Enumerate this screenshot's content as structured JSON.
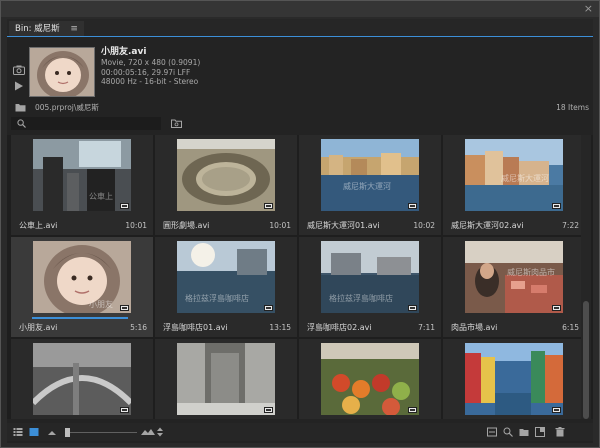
{
  "panel": {
    "tab_label": "Bin: 威尼斯",
    "tab_menu_glyph": "≡",
    "close_glyph": "×"
  },
  "preview": {
    "clip_name": "小朋友.avi",
    "line1": "Movie, 720 x 480 (0.9091)",
    "line2": "00:00:05:16, 29.97i LFF",
    "line3": "48000 Hz - 16-bit - Stereo"
  },
  "path": {
    "text": "005.prproj\\威尼斯",
    "items_count": "18 Items"
  },
  "clips": [
    {
      "name": "公車上.avi",
      "duration": "10:01",
      "watermark": "公車上"
    },
    {
      "name": "圓形劇場.avi",
      "duration": "10:01",
      "watermark": ""
    },
    {
      "name": "威尼斯大運河01.avi",
      "duration": "10:02",
      "watermark": "威尼斯大運河"
    },
    {
      "name": "威尼斯大運河02.avi",
      "duration": "7:22",
      "watermark": "威尼斯大運河"
    },
    {
      "name": "小朋友.avi",
      "duration": "5:16",
      "watermark": "小朋友"
    },
    {
      "name": "浮島咖啡店01.avi",
      "duration": "13:15",
      "watermark": "格拉兹浮島咖啡店"
    },
    {
      "name": "浮島咖啡店02.avi",
      "duration": "7:11",
      "watermark": "格拉兹浮島咖啡店"
    },
    {
      "name": "肉品市場.avi",
      "duration": "6:15",
      "watermark": "威尼斯肉品市"
    },
    {
      "name": "",
      "duration": "",
      "watermark": ""
    },
    {
      "name": "",
      "duration": "",
      "watermark": ""
    },
    {
      "name": "",
      "duration": "",
      "watermark": ""
    },
    {
      "name": "",
      "duration": "",
      "watermark": ""
    }
  ],
  "colors": {
    "accent": "#3c8fd8",
    "panel_bg": "#232323",
    "cell_bg": "#2a2a2a"
  }
}
